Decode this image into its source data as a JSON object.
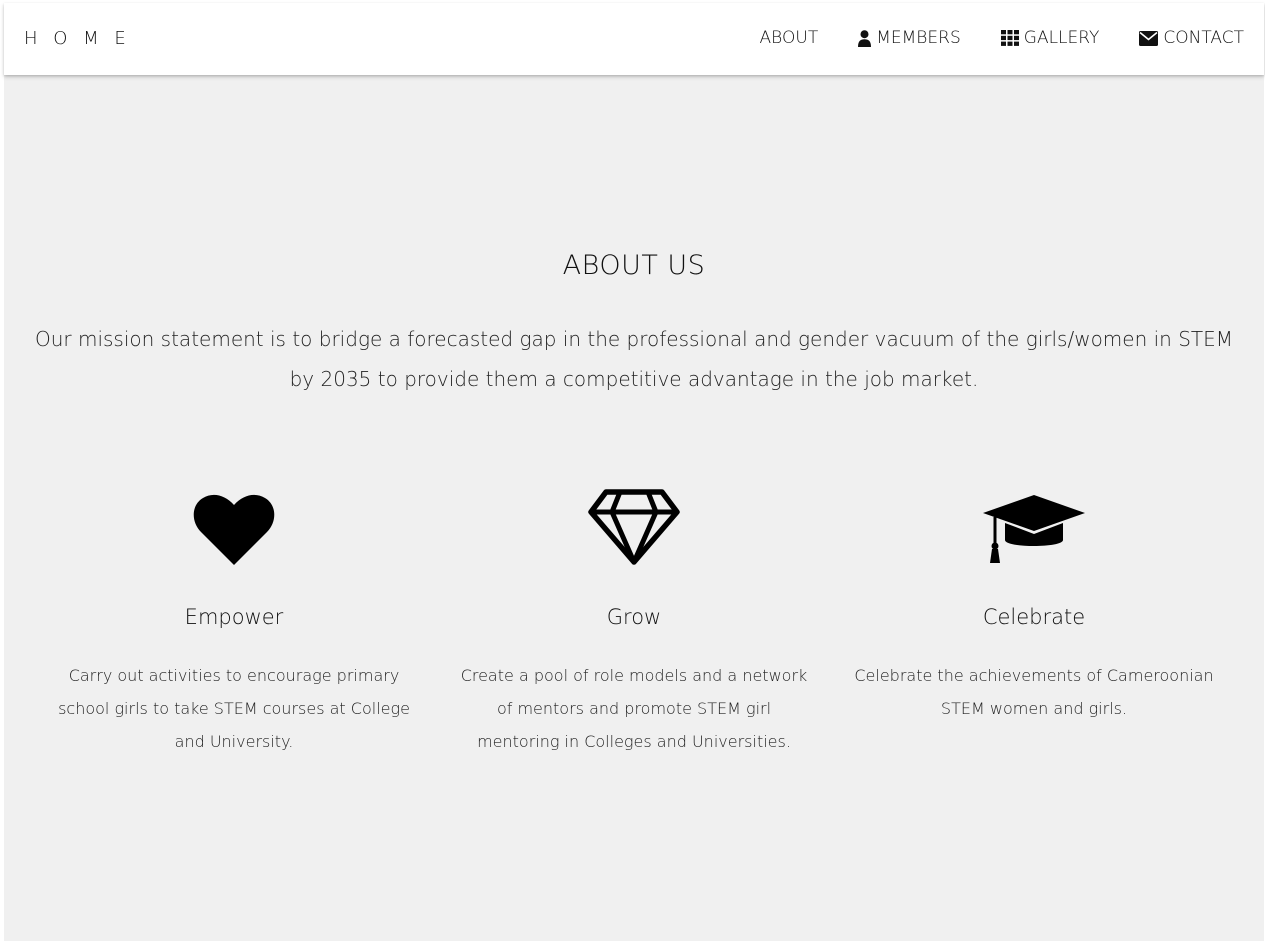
{
  "nav": {
    "home_label": "H O M E",
    "links": [
      {
        "label": "ABOUT",
        "icon": "none"
      },
      {
        "label": "MEMBERS",
        "icon": "user-icon"
      },
      {
        "label": "GALLERY",
        "icon": "grid-icon"
      },
      {
        "label": "CONTACT",
        "icon": "envelope-icon"
      }
    ]
  },
  "about": {
    "title": "ABOUT US",
    "mission": "Our mission statement is to bridge a forecasted gap in the professional and gender vacuum of the girls/women in STEM by 2035 to provide them a competitive advantage in the job market."
  },
  "features": [
    {
      "icon": "heart-icon",
      "title": "Empower",
      "text": "Carry out activities to encourage primary school girls to take STEM courses at College and University."
    },
    {
      "icon": "diamond-icon",
      "title": "Grow",
      "text": "Create a pool of role models and a network of mentors and promote STEM girl mentoring in Colleges and Universities."
    },
    {
      "icon": "graduation-cap-icon",
      "title": "Celebrate",
      "text": "Celebrate the achievements of Cameroonian STEM women and girls."
    }
  ],
  "colors": {
    "background": "#f0f0f0",
    "navbar": "#ffffff",
    "text": "#111111"
  }
}
